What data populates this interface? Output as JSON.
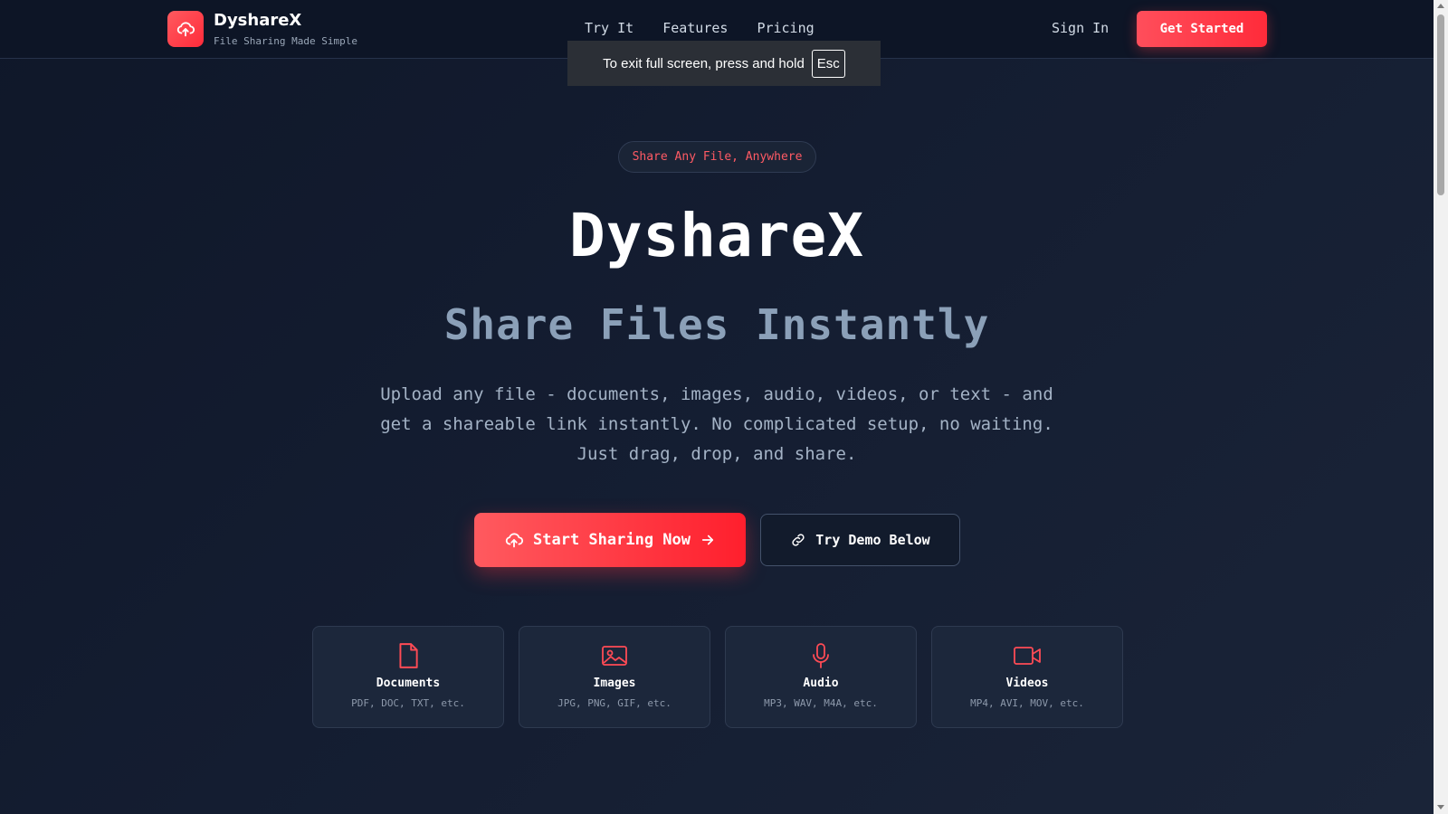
{
  "header": {
    "brand_name": "DyshareX",
    "brand_tagline": "File Sharing Made Simple",
    "nav": [
      "Try It",
      "Features",
      "Pricing"
    ],
    "sign_in": "Sign In",
    "get_started": "Get Started"
  },
  "fullscreen_notice": {
    "text": "To exit full screen, press and hold",
    "key": "Esc"
  },
  "hero": {
    "pill": "Share Any File, Anywhere",
    "title": "DyshareX",
    "subtitle": "Share Files Instantly",
    "description": "Upload any file - documents, images, audio, videos, or text - and get a shareable link instantly. No complicated setup, no waiting. Just drag, drop, and share.",
    "primary_button": "Start Sharing Now",
    "secondary_button": "Try Demo Below"
  },
  "file_types": [
    {
      "title": "Documents",
      "formats": "PDF, DOC, TXT, etc.",
      "icon": "document-icon"
    },
    {
      "title": "Images",
      "formats": "JPG, PNG, GIF, etc.",
      "icon": "image-icon"
    },
    {
      "title": "Audio",
      "formats": "MP3, WAV, M4A, etc.",
      "icon": "microphone-icon"
    },
    {
      "title": "Videos",
      "formats": "MP4, AVI, MOV, etc.",
      "icon": "video-camera-icon"
    }
  ],
  "colors": {
    "accent": "#ff3b46",
    "background": "#111a2c",
    "muted_text": "#8ba0b8"
  }
}
